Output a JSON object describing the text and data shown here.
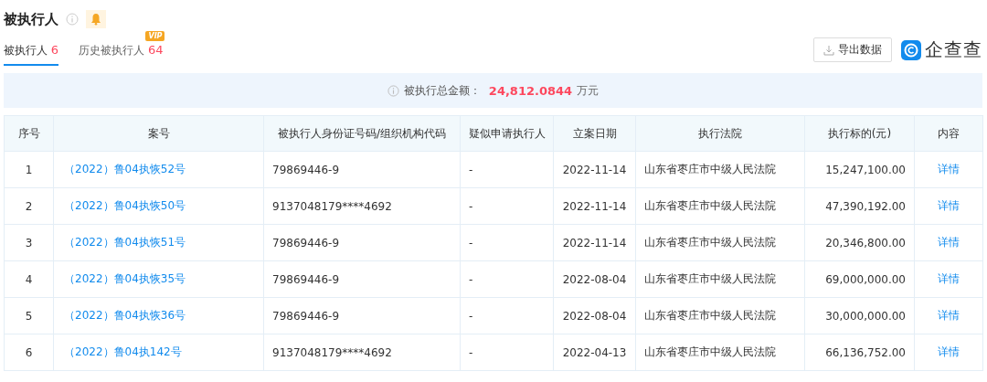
{
  "title": "被执行人",
  "tabs": [
    {
      "label": "被执行人",
      "count": "6",
      "selected": true
    },
    {
      "label": "历史被执行人",
      "count": "64",
      "selected": false,
      "badge": "VIP"
    }
  ],
  "export_button": "导出数据",
  "logo": "企查查",
  "summary": {
    "label": "被执行总金额：",
    "amount": "24,812.0844",
    "unit": "万元"
  },
  "table": {
    "columns": [
      "序号",
      "案号",
      "被执行人身份证号码/组织机构代码",
      "疑似申请执行人",
      "立案日期",
      "执行法院",
      "执行标的(元)",
      "内容"
    ],
    "rows": [
      [
        "1",
        "（2022）鲁04执恢52号",
        "79869446-9",
        "-",
        "2022-11-14",
        "山东省枣庄市中级人民法院",
        "15,247,100.00",
        "详情"
      ],
      [
        "2",
        "（2022）鲁04执恢50号",
        "9137048179****4692",
        "-",
        "2022-11-14",
        "山东省枣庄市中级人民法院",
        "47,390,192.00",
        "详情"
      ],
      [
        "3",
        "（2022）鲁04执恢51号",
        "79869446-9",
        "-",
        "2022-11-14",
        "山东省枣庄市中级人民法院",
        "20,346,800.00",
        "详情"
      ],
      [
        "4",
        "（2022）鲁04执恢35号",
        "79869446-9",
        "-",
        "2022-08-04",
        "山东省枣庄市中级人民法院",
        "69,000,000.00",
        "详情"
      ],
      [
        "5",
        "（2022）鲁04执恢36号",
        "79869446-9",
        "-",
        "2022-08-04",
        "山东省枣庄市中级人民法院",
        "30,000,000.00",
        "详情"
      ],
      [
        "6",
        "（2022）鲁04执142号",
        "9137048179****4692",
        "-",
        "2022-04-13",
        "山东省枣庄市中级人民法院",
        "66,136,752.00",
        "详情"
      ]
    ]
  }
}
